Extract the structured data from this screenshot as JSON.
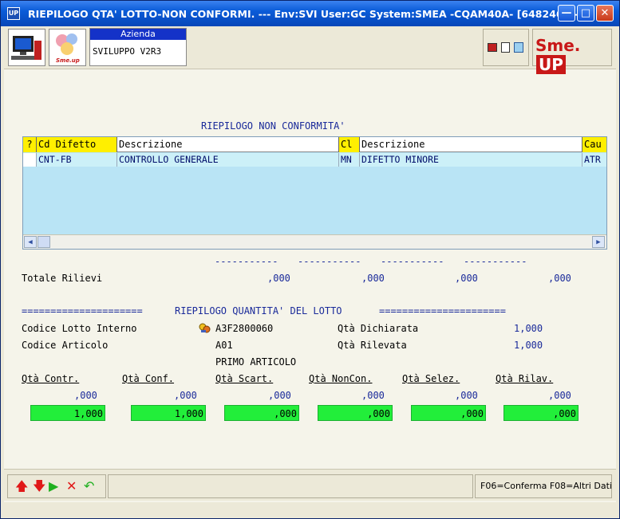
{
  "window": {
    "title": "RIEPILOGO QTA' LOTTO-NON CONFORMI. --- Env:SVI User:GC System:SMEA -CQAM40A- [648246-3-1]",
    "app_icon_text": "UP"
  },
  "toolbar": {
    "azienda_label": "Azienda",
    "azienda_value": "SVILUPPO V2R3",
    "logo_sme": "Sme.",
    "logo_up": "UP",
    "logo_small": "Sme.up"
  },
  "section_title": "RIEPILOGO NON CONFORMITA'",
  "grid": {
    "columns": [
      "?",
      "Cd Difetto",
      "Descrizione",
      "Cl",
      "Descrizione",
      "Cau"
    ],
    "rows": [
      {
        "q": "",
        "cd": "CNT-FB",
        "descr": "CONTROLLO GENERALE",
        "cl": "MN",
        "descr2": "DIFETTO MINORE",
        "cau": "ATR"
      }
    ]
  },
  "totals": {
    "dashes": [
      "-----------",
      "-----------",
      "-----------",
      "-----------"
    ],
    "label": "Totale Rilievi",
    "values": [
      ",000",
      ",000",
      ",000",
      ",000"
    ]
  },
  "lotto": {
    "rule_left": "=====================",
    "title": "RIEPILOGO QUANTITA' DEL LOTTO",
    "rule_right": "======================",
    "codice_lotto_label": "Codice Lotto Interno",
    "codice_lotto_value": "A3F2800060",
    "qta_dichiarata_label": "Qtà Dichiarata",
    "qta_dichiarata_value": "1,000",
    "codice_articolo_label": "Codice Articolo",
    "codice_articolo_value": "A01",
    "qta_rilevata_label": "Qtà Rilevata",
    "qta_rilevata_value": "1,000",
    "primo_articolo": "PRIMO ARTICOLO"
  },
  "qty": {
    "headers": [
      "Qtà Contr.",
      "Qtà Conf.",
      "Qtà Scart.",
      "Qtà NonCon.",
      "Qtà Selez.",
      "Qtà Rilav."
    ],
    "values": [
      ",000",
      ",000",
      ",000",
      ",000",
      ",000",
      ",000"
    ],
    "inputs": [
      "1,000",
      "1,000",
      ",000",
      ",000",
      ",000",
      ",000"
    ]
  },
  "status": {
    "fkeys": "F06=Conferma   F08=Altri Dati"
  },
  "colors": {
    "titlebar": "#0a5bd8",
    "header_yellow": "#ffef00",
    "row_cyan": "#b9e4f5",
    "input_green": "#22ee3a",
    "text_blue": "#1a2a9a"
  }
}
